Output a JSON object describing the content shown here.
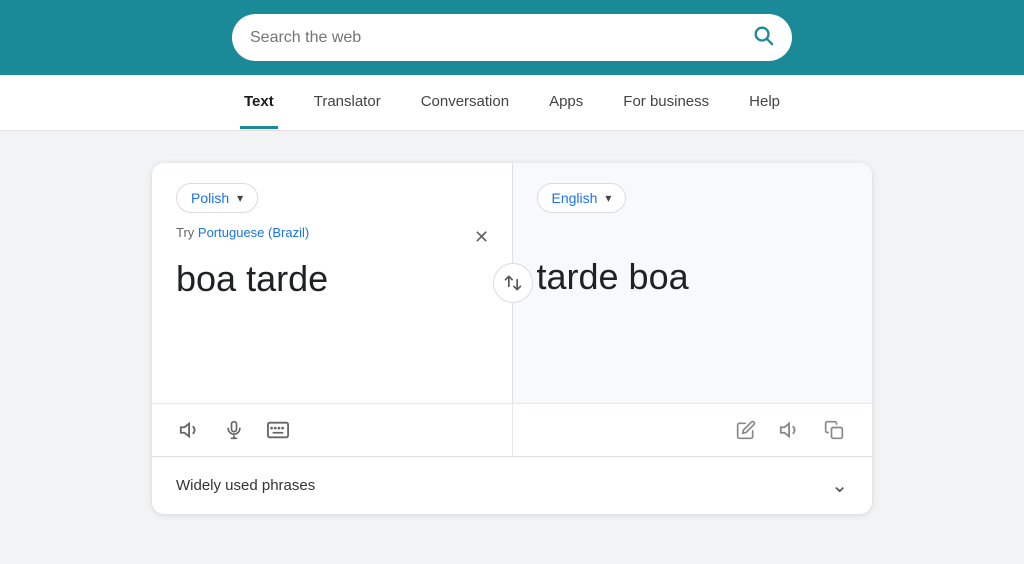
{
  "header": {
    "search_placeholder": "Search the web",
    "bg_color": "#1a8a99"
  },
  "nav": {
    "items": [
      {
        "id": "text",
        "label": "Text",
        "active": true
      },
      {
        "id": "translator",
        "label": "Translator",
        "active": false
      },
      {
        "id": "conversation",
        "label": "Conversation",
        "active": false
      },
      {
        "id": "apps",
        "label": "Apps",
        "active": false
      },
      {
        "id": "for-business",
        "label": "For business",
        "active": false
      },
      {
        "id": "help",
        "label": "Help",
        "active": false
      }
    ]
  },
  "translator": {
    "source_lang": "Polish",
    "target_lang": "English",
    "suggestion_prefix": "Try ",
    "suggestion_link": "Portuguese (Brazil)",
    "source_text": "boa tarde",
    "target_text": "tarde boa",
    "phrases_label": "Widely used phrases"
  }
}
